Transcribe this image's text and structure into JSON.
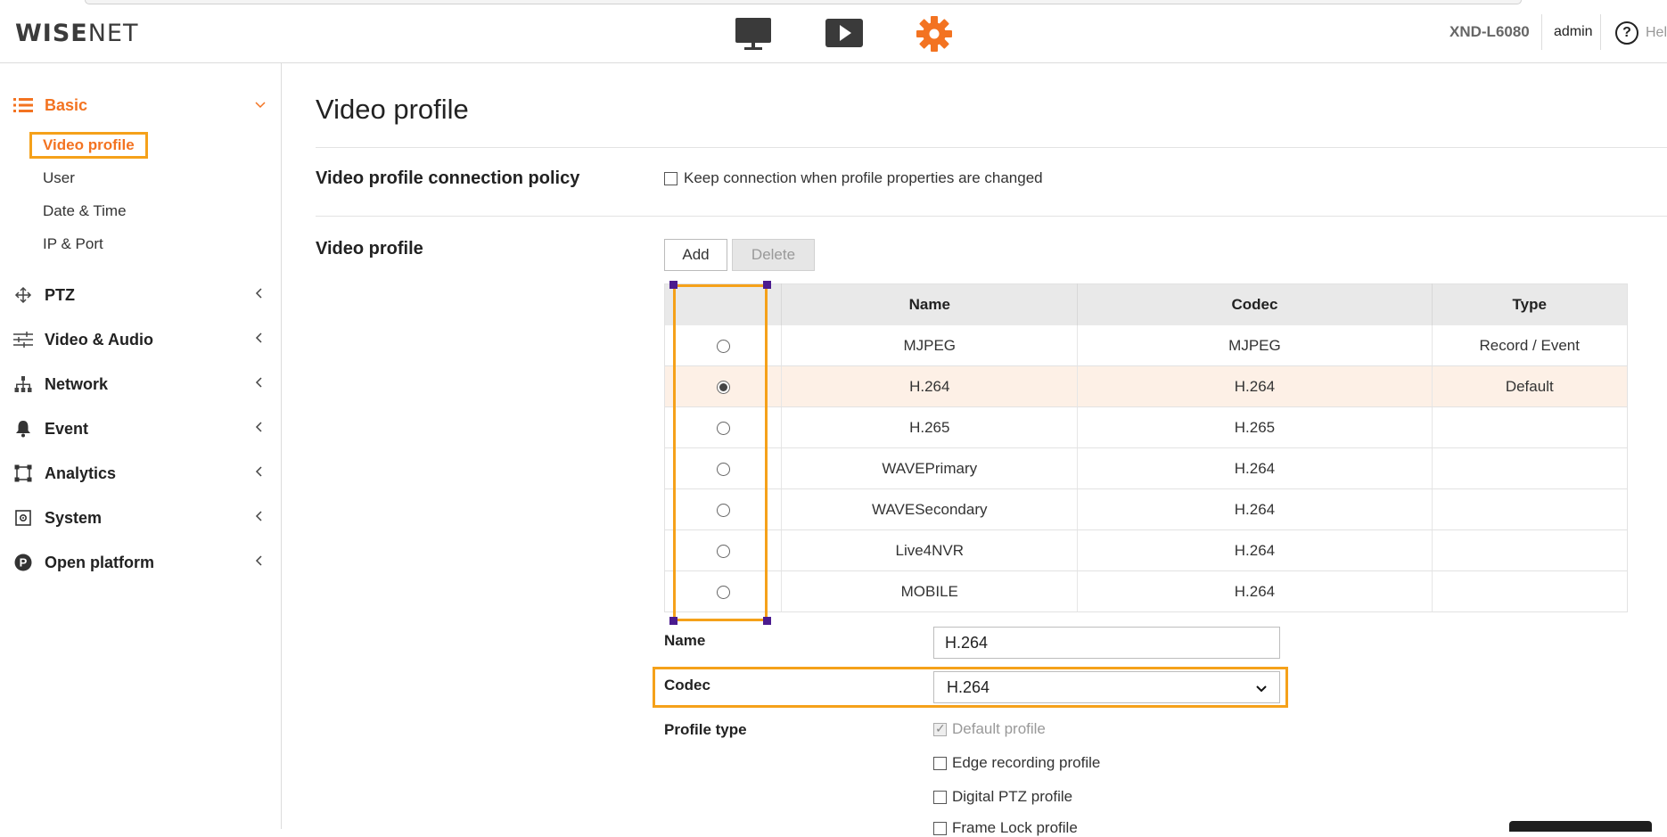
{
  "header": {
    "logo_bold": "WISE",
    "logo_light": "NET",
    "nav_icons": [
      "monitor-icon",
      "play-icon",
      "gear-icon"
    ],
    "model": "XND-L6080",
    "user": "admin",
    "help_label": "Help"
  },
  "sidebar": {
    "basic": {
      "label": "Basic",
      "icon": "list-icon"
    },
    "basic_items": [
      "Video profile",
      "User",
      "Date & Time",
      "IP & Port"
    ],
    "selected_item": "Video profile",
    "menus": [
      {
        "label": "PTZ",
        "icon": "move-arrows-icon"
      },
      {
        "label": "Video & Audio",
        "icon": "sliders-icon"
      },
      {
        "label": "Network",
        "icon": "network-tree-icon"
      },
      {
        "label": "Event",
        "icon": "bell-icon"
      },
      {
        "label": "Analytics",
        "icon": "frame-icon"
      },
      {
        "label": "System",
        "icon": "system-icon"
      },
      {
        "label": "Open platform",
        "icon": "open-platform-icon"
      }
    ],
    "accent_color": "#f37321"
  },
  "main": {
    "title": "Video profile",
    "policy": {
      "label": "Video profile connection policy",
      "checkbox_label": "Keep connection when profile properties are changed",
      "checked": false
    },
    "profiles": {
      "label": "Video profile",
      "add_label": "Add",
      "delete_label": "Delete",
      "columns": [
        "",
        "Name",
        "Codec",
        "Type"
      ],
      "rows": [
        {
          "name": "MJPEG",
          "codec": "MJPEG",
          "type": "Record / Event",
          "selected": false
        },
        {
          "name": "H.264",
          "codec": "H.264",
          "type": "Default",
          "selected": true
        },
        {
          "name": "H.265",
          "codec": "H.265",
          "type": "",
          "selected": false
        },
        {
          "name": "WAVEPrimary",
          "codec": "H.264",
          "type": "",
          "selected": false
        },
        {
          "name": "WAVESecondary",
          "codec": "H.264",
          "type": "",
          "selected": false
        },
        {
          "name": "Live4NVR",
          "codec": "H.264",
          "type": "",
          "selected": false
        },
        {
          "name": "MOBILE",
          "codec": "H.264",
          "type": "",
          "selected": false
        }
      ]
    },
    "form": {
      "name_label": "Name",
      "name_value": "H.264",
      "codec_label": "Codec",
      "codec_value": "H.264",
      "profile_type_label": "Profile type",
      "profile_types": [
        {
          "label": "Default profile",
          "checked": true,
          "disabled": true
        },
        {
          "label": "Edge recording profile",
          "checked": false,
          "disabled": false
        },
        {
          "label": "Digital PTZ profile",
          "checked": false,
          "disabled": false
        },
        {
          "label": "Frame Lock profile",
          "checked": false,
          "disabled": false
        }
      ]
    },
    "highlight_color": "#f5a11a"
  }
}
